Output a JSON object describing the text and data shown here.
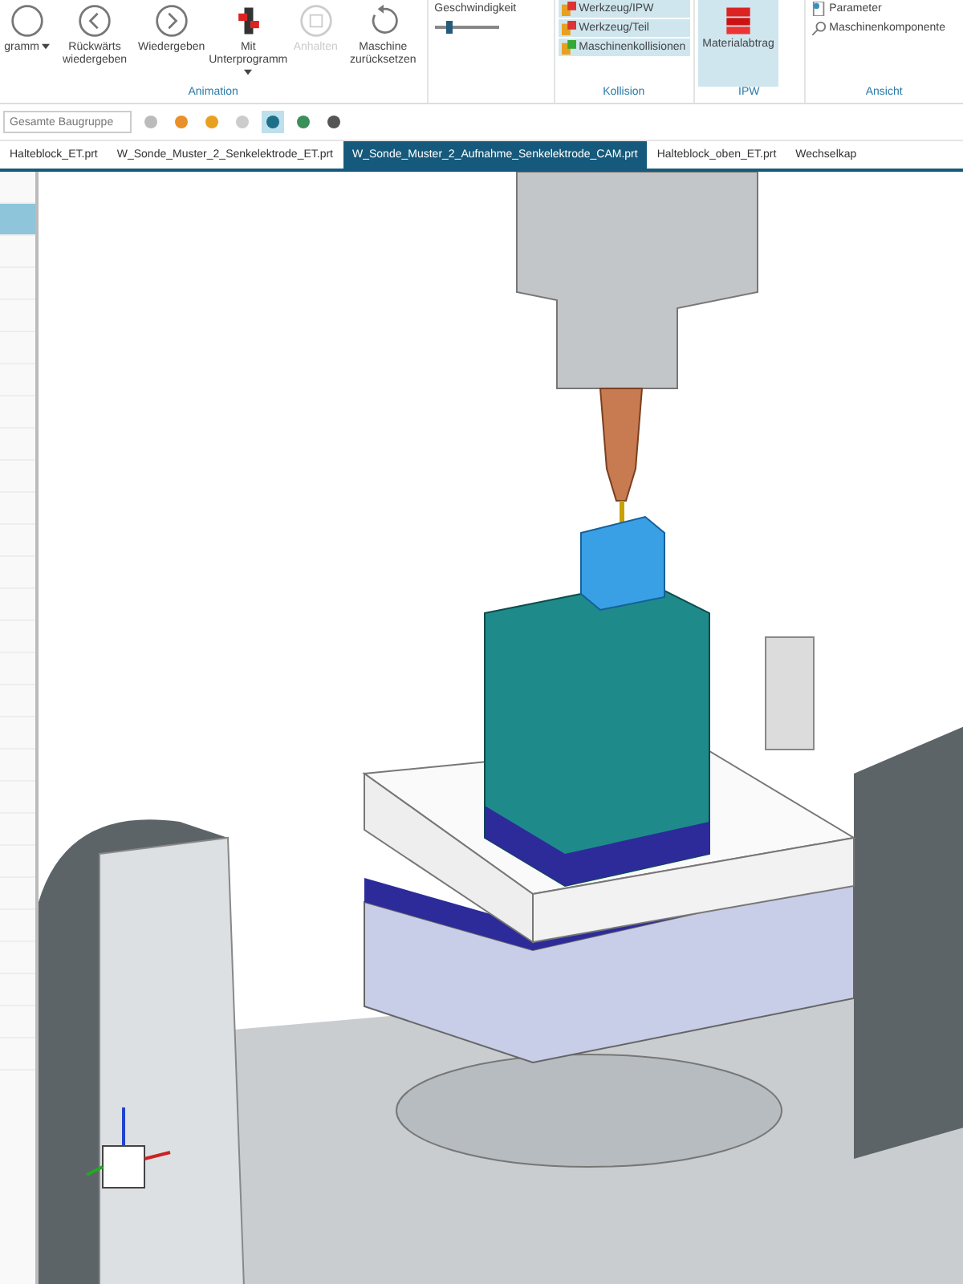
{
  "ribbon": {
    "animation": {
      "label": "Animation",
      "buttons": [
        {
          "label": "gramm",
          "dropdown": true,
          "disabled": false
        },
        {
          "label": "Rückwärts wiedergeben",
          "dropdown": false,
          "disabled": false
        },
        {
          "label": "Wiedergeben",
          "dropdown": false,
          "disabled": false
        },
        {
          "label": "Mit Unterprogramm",
          "dropdown": true,
          "disabled": false
        },
        {
          "label": "Anhalten",
          "dropdown": false,
          "disabled": true
        },
        {
          "label": "Maschine zurücksetzen",
          "dropdown": false,
          "disabled": false
        }
      ]
    },
    "speed": {
      "label": "Geschwindigkeit",
      "level": 0.2
    },
    "collision": {
      "label": "Kollision",
      "items": [
        {
          "label": "Werkzeug/IPW",
          "on": true
        },
        {
          "label": "Werkzeug/Teil",
          "on": true
        },
        {
          "label": "Maschinenkollisionen",
          "on": true
        }
      ]
    },
    "ipw": {
      "label": "IPW",
      "button": {
        "label": "Materialabtrag",
        "on": true
      }
    },
    "view": {
      "label": "Ansicht",
      "items": [
        "Parameter",
        "Maschinenkomponente"
      ]
    }
  },
  "toolbar": {
    "scope_field": {
      "placeholder": "Gesamte Baugruppe"
    },
    "tools": [
      {
        "selected": false
      },
      {
        "selected": false
      },
      {
        "selected": false
      },
      {
        "selected": false
      },
      {
        "selected": true
      },
      {
        "selected": false
      },
      {
        "selected": false
      }
    ]
  },
  "tabs": [
    {
      "label": "Halteblock_ET.prt",
      "selected": false
    },
    {
      "label": "W_Sonde_Muster_2_Senkelektrode_ET.prt",
      "selected": false
    },
    {
      "label": "W_Sonde_Muster_2_Aufnahme_Senkelektrode_CAM.prt",
      "selected": true
    },
    {
      "label": "Halteblock_oben_ET.prt",
      "selected": false
    },
    {
      "label": "Wechselkap",
      "selected": false
    }
  ],
  "navigator": {
    "rows": [
      {
        "selected": false
      },
      {
        "selected": true
      },
      {
        "selected": false
      },
      {
        "selected": false
      },
      {
        "selected": false
      },
      {
        "selected": false
      },
      {
        "selected": false
      },
      {
        "selected": false
      },
      {
        "selected": false
      },
      {
        "selected": false
      },
      {
        "selected": false
      },
      {
        "selected": false
      },
      {
        "selected": false
      },
      {
        "selected": false
      },
      {
        "selected": false
      },
      {
        "selected": false
      },
      {
        "selected": false
      },
      {
        "selected": false
      },
      {
        "selected": false
      },
      {
        "selected": false
      },
      {
        "selected": false
      },
      {
        "selected": false
      },
      {
        "selected": false
      },
      {
        "selected": false
      },
      {
        "selected": false
      },
      {
        "selected": false
      },
      {
        "selected": false
      },
      {
        "selected": false
      }
    ]
  }
}
